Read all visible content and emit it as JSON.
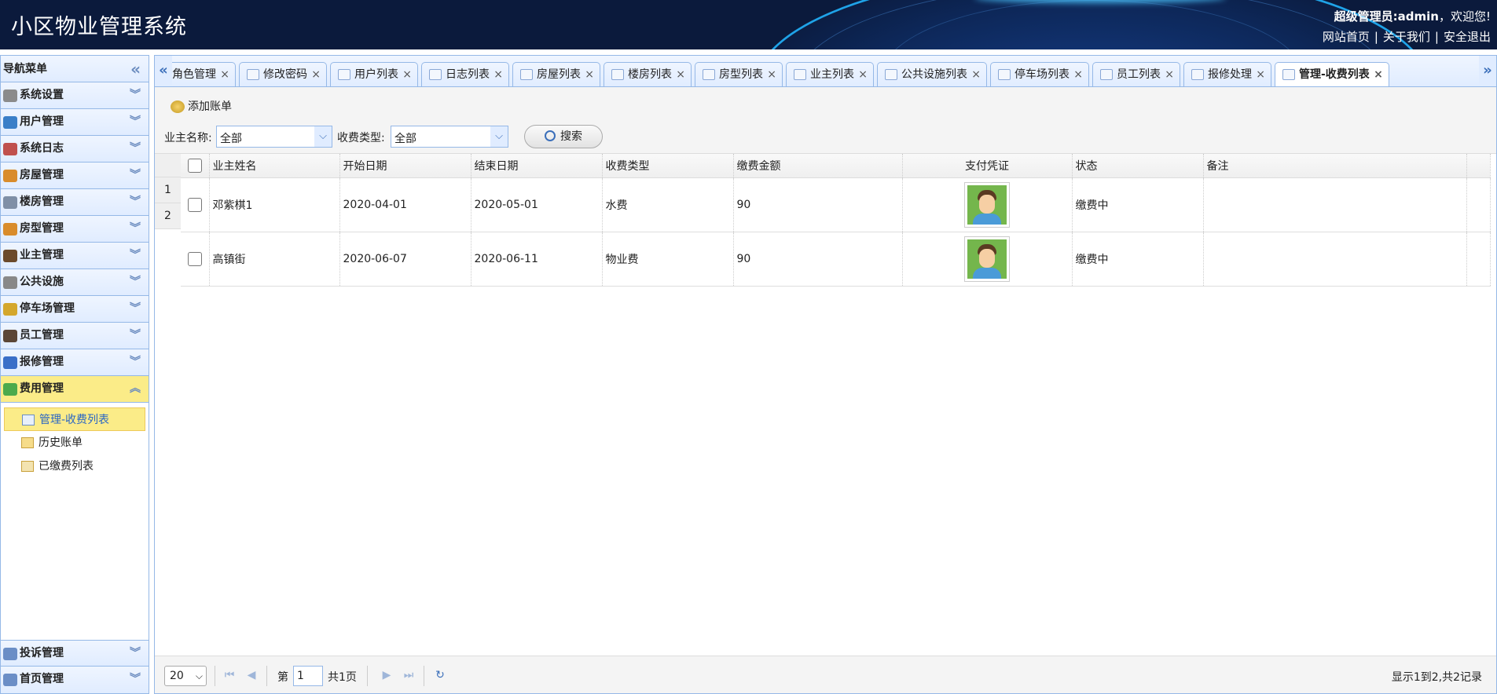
{
  "header": {
    "title": "小区物业管理系统",
    "user_role": "超级管理员:admin",
    "welcome": "，欢迎您!",
    "links": [
      "网站首页",
      "关于我们",
      "安全退出"
    ]
  },
  "sidebar": {
    "title": "导航菜单",
    "items": [
      {
        "label": "系统设置",
        "icon": "gear-icon",
        "color": "#8b8b8b"
      },
      {
        "label": "用户管理",
        "icon": "users-icon",
        "color": "#3a7fc8"
      },
      {
        "label": "系统日志",
        "icon": "log-icon",
        "color": "#c0504d"
      },
      {
        "label": "房屋管理",
        "icon": "house-icon",
        "color": "#d98c2b"
      },
      {
        "label": "楼房管理",
        "icon": "building-icon",
        "color": "#7f8fa6"
      },
      {
        "label": "房型管理",
        "icon": "house-type-icon",
        "color": "#d98c2b"
      },
      {
        "label": "业主管理",
        "icon": "owner-icon",
        "color": "#6b4a2b"
      },
      {
        "label": "公共设施",
        "icon": "tools-icon",
        "color": "#888888"
      },
      {
        "label": "停车场管理",
        "icon": "key-icon",
        "color": "#d4a72c"
      },
      {
        "label": "员工管理",
        "icon": "staff-icon",
        "color": "#5b4636"
      },
      {
        "label": "报修管理",
        "icon": "repair-icon",
        "color": "#3a6fc8"
      },
      {
        "label": "费用管理",
        "icon": "money-icon",
        "color": "#4caa4c"
      }
    ],
    "sub_items": [
      {
        "label": "管理-收费列表",
        "icon": "list-icon"
      },
      {
        "label": "历史账单",
        "icon": "folder-icon"
      },
      {
        "label": "已缴费列表",
        "icon": "paid-icon"
      }
    ],
    "bottom_items": [
      {
        "label": "投诉管理",
        "icon": "complaint-icon",
        "color": "#6b8ec6"
      },
      {
        "label": "首页管理",
        "icon": "home-list-icon",
        "color": "#6b8ec6"
      }
    ]
  },
  "tabs": [
    {
      "label": "角色管理"
    },
    {
      "label": "修改密码"
    },
    {
      "label": "用户列表"
    },
    {
      "label": "日志列表"
    },
    {
      "label": "房屋列表"
    },
    {
      "label": "楼房列表"
    },
    {
      "label": "房型列表"
    },
    {
      "label": "业主列表"
    },
    {
      "label": "公共设施列表"
    },
    {
      "label": "停车场列表"
    },
    {
      "label": "员工列表"
    },
    {
      "label": "报修处理"
    },
    {
      "label": "管理-收费列表"
    }
  ],
  "toolbar": {
    "add_label": "添加账单",
    "owner_label": "业主名称:",
    "owner_value": "全部",
    "type_label": "收费类型:",
    "type_value": "全部",
    "search_label": "搜索"
  },
  "grid": {
    "columns": [
      "业主姓名",
      "开始日期",
      "结束日期",
      "收费类型",
      "缴费金额",
      "支付凭证",
      "状态",
      "备注"
    ],
    "rows": [
      {
        "num": "1",
        "name": "邓紫棋1",
        "start": "2020-04-01",
        "end": "2020-05-01",
        "type": "水费",
        "amount": "90",
        "status": "缴费中",
        "note": ""
      },
      {
        "num": "2",
        "name": "高镇街",
        "start": "2020-06-07",
        "end": "2020-06-11",
        "type": "物业费",
        "amount": "90",
        "status": "缴费中",
        "note": ""
      }
    ]
  },
  "pager": {
    "page_size": "20",
    "page_prefix": "第",
    "page_value": "1",
    "page_total": "共1页",
    "info": "显示1到2,共2记录"
  }
}
